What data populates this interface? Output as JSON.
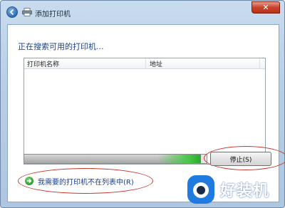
{
  "window": {
    "title": "添加打印机",
    "close_glyph": "✕",
    "back_icon": "back-arrow-icon",
    "title_icon": "printer-icon"
  },
  "main": {
    "heading": "正在搜索可用的打印机...",
    "columns": [
      "打印机名称",
      "地址"
    ],
    "search_progress": 0.97,
    "stop_button": "停止(S)",
    "not_listed_link": "我需要的打印机不在列表中(R)",
    "link_icon": "green-arrow-icon"
  },
  "watermark": {
    "text": "好装机"
  },
  "colors": {
    "heading_blue": "#1e3f88",
    "link_blue": "#1a3d96",
    "annotation_red": "#c8362b",
    "progress_green": "#48c848",
    "close_red": "#c9432c"
  }
}
